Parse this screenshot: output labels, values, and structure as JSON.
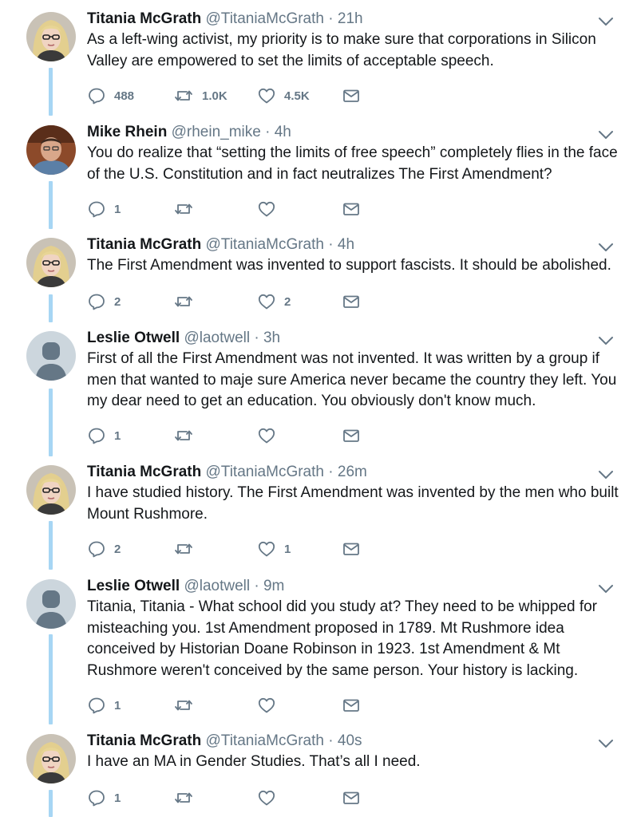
{
  "tweets": [
    {
      "name": "Titania McGrath",
      "handle": "@TitaniaMcGrath",
      "time": "21h",
      "text": "As a left-wing activist, my priority is to make sure that corporations in Silicon Valley are empowered to set the limits of acceptable speech.",
      "replies": "488",
      "retweets": "1.0K",
      "likes": "4.5K",
      "avatar": "titania"
    },
    {
      "name": "Mike Rhein",
      "handle": "@rhein_mike",
      "time": "4h",
      "text": "You do realize that “setting the limits of free speech” completely flies in the face of the U.S. Constitution and in fact neutralizes The First Amendment?",
      "replies": "1",
      "retweets": "",
      "likes": "",
      "avatar": "mike"
    },
    {
      "name": "Titania McGrath",
      "handle": "@TitaniaMcGrath",
      "time": "4h",
      "text": "The First Amendment was invented to support fascists. It should be abolished.",
      "replies": "2",
      "retweets": "",
      "likes": "2",
      "avatar": "titania"
    },
    {
      "name": "Leslie Otwell",
      "handle": "@laotwell",
      "time": "3h",
      "text": "First of all the First Amendment was not invented. It was written by a group if men that wanted to maje sure America never became the country they left. You my dear need to get an education. You obviously don't know much.",
      "replies": "1",
      "retweets": "",
      "likes": "",
      "avatar": "default"
    },
    {
      "name": "Titania McGrath",
      "handle": "@TitaniaMcGrath",
      "time": "26m",
      "text": "I have studied history. The First Amendment was invented by the men who built Mount Rushmore.",
      "replies": "2",
      "retweets": "",
      "likes": "1",
      "avatar": "titania"
    },
    {
      "name": "Leslie Otwell",
      "handle": "@laotwell",
      "time": "9m",
      "text": "Titania, Titania - What school did you study at? They need to be whipped for misteaching you. 1st Amendment proposed in 1789. Mt Rushmore idea conceived by Historian Doane Robinson in 1923. 1st Amendment & Mt Rushmore weren't conceived by the same person. Your history is lacking.",
      "replies": "1",
      "retweets": "",
      "likes": "",
      "avatar": "default"
    },
    {
      "name": "Titania McGrath",
      "handle": "@TitaniaMcGrath",
      "time": "40s",
      "text": "I have an MA in Gender Studies. That’s all I need.",
      "replies": "1",
      "retweets": "",
      "likes": "",
      "avatar": "titania"
    }
  ],
  "separator": "·",
  "colors": {
    "thread_line": "#a7d6f4",
    "icon_gray": "#657786",
    "text": "#14171a"
  },
  "icons": {
    "reply": "reply-icon",
    "retweet": "retweet-icon",
    "like": "heart-icon",
    "dm": "envelope-icon",
    "menu": "chevron-down-icon"
  }
}
